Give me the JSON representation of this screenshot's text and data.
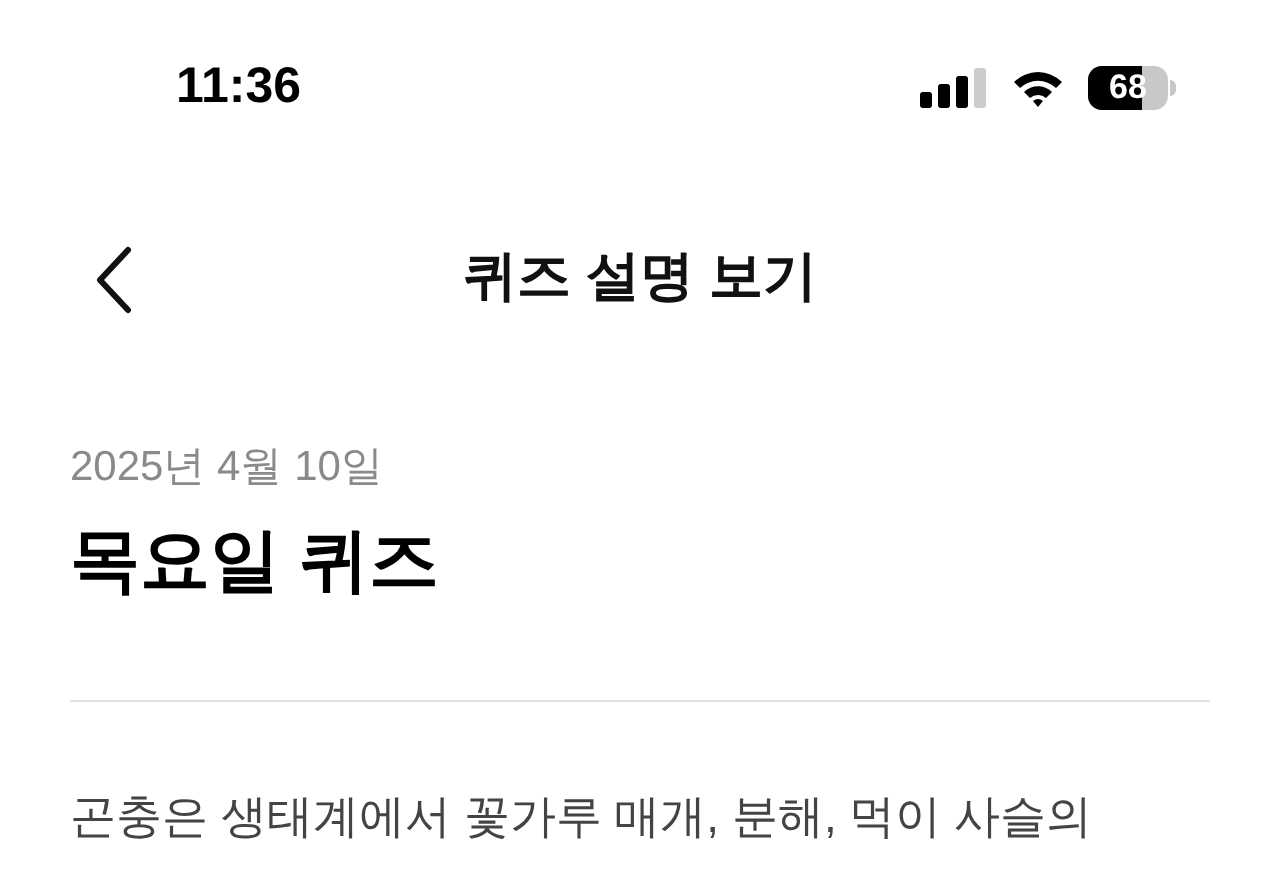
{
  "status_bar": {
    "time": "11:36",
    "battery": "68"
  },
  "nav": {
    "title": "퀴즈 설명 보기"
  },
  "quiz": {
    "date": "2025년 4월 10일",
    "title": "목요일 퀴즈",
    "body": "곤충은 생태계에서 꽃가루 매개, 분해, 먹이 사슬의"
  }
}
